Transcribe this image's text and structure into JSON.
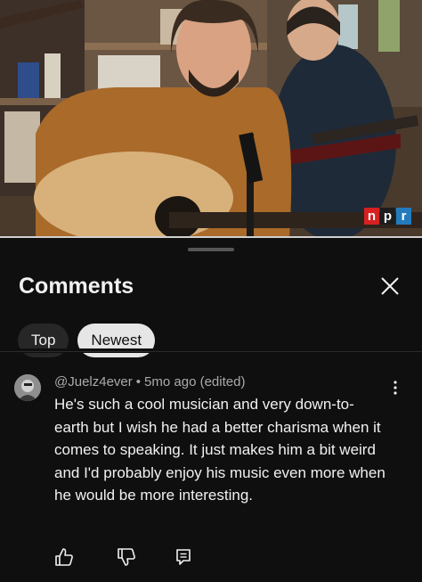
{
  "video": {
    "logo_letters": [
      "n",
      "p",
      "r"
    ]
  },
  "comments_panel": {
    "title": "Comments",
    "close_icon": "close-icon",
    "sort_chips": [
      {
        "label": "Top",
        "selected": false
      },
      {
        "label": "Newest",
        "selected": true
      }
    ]
  },
  "comment": {
    "author": "@Juelz4ever",
    "separator": "•",
    "time": "5mo ago (edited)",
    "text": "He's such a cool musician and very down-to-earth but I wish he had a better charisma when it comes to speaking. It just makes him a bit weird and I'd probably enjoy his music even more when he would be more interesting.",
    "icons": {
      "menu": "more-vertical-icon",
      "like": "thumbs-up-icon",
      "dislike": "thumbs-down-icon",
      "reply": "reply-icon"
    }
  },
  "colors": {
    "background": "#0f0f0f",
    "chip_selected": "#e6e6e6",
    "chip_unselected": "#272727",
    "npr_red": "#d62021",
    "npr_blue": "#237bbd"
  }
}
